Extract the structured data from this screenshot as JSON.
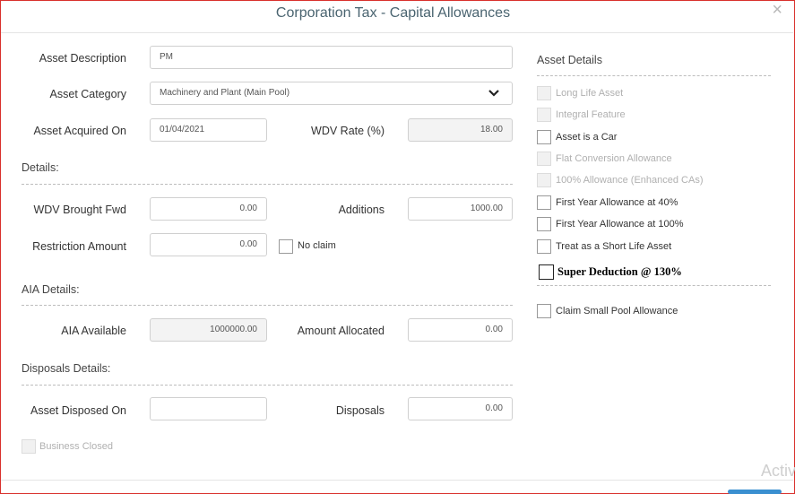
{
  "dialog": {
    "title": "Corporation Tax - Capital Allowances",
    "close": "×"
  },
  "form": {
    "asset_description": {
      "label": "Asset Description",
      "value": "PM"
    },
    "asset_category": {
      "label": "Asset Category",
      "value": "Machinery and Plant (Main Pool)"
    },
    "asset_acquired_on": {
      "label": "Asset Acquired On",
      "value": "01/04/2021"
    },
    "wdv_rate": {
      "label": "WDV Rate (%)",
      "value": "18.00"
    }
  },
  "details": {
    "heading": "Details:",
    "wdv_brought_fwd": {
      "label": "WDV Brought Fwd",
      "value": "0.00"
    },
    "additions": {
      "label": "Additions",
      "value": "1000.00"
    },
    "restriction_amount": {
      "label": "Restriction Amount",
      "value": "0.00"
    },
    "no_claim": {
      "label": "No claim",
      "checked": false
    }
  },
  "aia": {
    "heading": "AIA Details:",
    "aia_available": {
      "label": "AIA Available",
      "value": "1000000.00"
    },
    "amount_allocated": {
      "label": "Amount Allocated",
      "value": "0.00"
    }
  },
  "disposals": {
    "heading": "Disposals Details:",
    "asset_disposed_on": {
      "label": "Asset Disposed On",
      "value": ""
    },
    "disposals": {
      "label": "Disposals",
      "value": "0.00"
    },
    "business_closed": {
      "label": "Business Closed",
      "checked": false,
      "disabled": true
    }
  },
  "asset_details": {
    "heading": "Asset Details",
    "options": [
      {
        "label": "Long Life Asset",
        "disabled": true
      },
      {
        "label": "Integral Feature",
        "disabled": true
      },
      {
        "label": "Asset is a Car",
        "disabled": false
      },
      {
        "label": "Flat Conversion Allowance",
        "disabled": true
      },
      {
        "label": "100% Allowance (Enhanced CAs)",
        "disabled": true
      },
      {
        "label": "First Year Allowance at 40%",
        "disabled": false
      },
      {
        "label": "First Year Allowance at 100%",
        "disabled": false
      },
      {
        "label": "Treat as a Short Life Asset",
        "disabled": false
      }
    ],
    "super_deduction": "Super Deduction @ 130%",
    "small_pool": "Claim Small Pool Allowance"
  },
  "watermark": "Activ"
}
